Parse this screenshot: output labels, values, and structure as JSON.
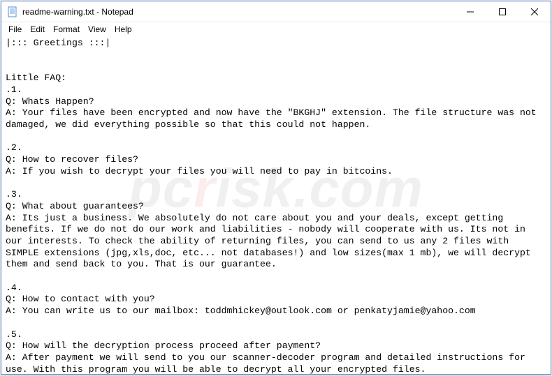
{
  "titlebar": {
    "filename": "readme-warning.txt",
    "appname": "Notepad",
    "separator": " - "
  },
  "menubar": {
    "items": [
      "File",
      "Edit",
      "Format",
      "View",
      "Help"
    ]
  },
  "content": {
    "lines": [
      "|::: Greetings :::|",
      "",
      "",
      "Little FAQ:",
      ".1.",
      "Q: Whats Happen?",
      "A: Your files have been encrypted and now have the \"BKGHJ\" extension. The file structure was not damaged, we did everything possible so that this could not happen.",
      "",
      ".2.",
      "Q: How to recover files?",
      "A: If you wish to decrypt your files you will need to pay in bitcoins.",
      "",
      ".3.",
      "Q: What about guarantees?",
      "A: Its just a business. We absolutely do not care about you and your deals, except getting benefits. If we do not do our work and liabilities - nobody will cooperate with us. Its not in our interests. To check the ability of returning files, you can send to us any 2 files with SIMPLE extensions (jpg,xls,doc, etc... not databases!) and low sizes(max 1 mb), we will decrypt them and send back to you. That is our guarantee.",
      "",
      ".4.",
      "Q: How to contact with you?",
      "A: You can write us to our mailbox: toddmhickey@outlook.com or penkatyjamie@yahoo.com",
      "",
      ".5.",
      "Q: How will the decryption process proceed after payment?",
      "A: After payment we will send to you our scanner-decoder program and detailed instructions for use. With this program you will be able to decrypt all your encrypted files."
    ]
  },
  "watermark": {
    "prefix": "pc",
    "highlight": "r",
    "suffix": "isk.com"
  }
}
